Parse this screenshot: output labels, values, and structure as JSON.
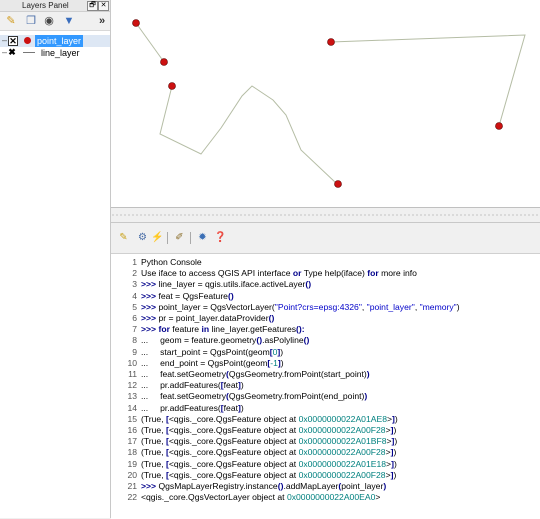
{
  "layers_panel": {
    "title": "Layers Panel",
    "float_button": "🗗",
    "close_button": "✕",
    "layers": [
      {
        "name": "point_layer",
        "visible": true,
        "selected": true
      },
      {
        "name": "line_layer",
        "visible": true,
        "selected": false
      }
    ]
  },
  "console": {
    "lines": [
      {
        "n": "1",
        "parts": [
          [
            "Python Console",
            ""
          ]
        ]
      },
      {
        "n": "2",
        "parts": [
          [
            "Use iface to access QGIS API interface ",
            ""
          ],
          [
            "or",
            "kw"
          ],
          [
            " Type help(iface) ",
            ""
          ],
          [
            "for",
            "kw"
          ],
          [
            " more info",
            ""
          ]
        ]
      },
      {
        "n": "3",
        "parts": [
          [
            ">>> ",
            "kw"
          ],
          [
            "line_layer = qgis.utils.iface.activeLayer",
            ""
          ],
          [
            "()",
            "kw"
          ]
        ]
      },
      {
        "n": "4",
        "parts": [
          [
            ">>> ",
            "kw"
          ],
          [
            "feat = QgsFeature",
            ""
          ],
          [
            "()",
            "kw"
          ]
        ]
      },
      {
        "n": "5",
        "parts": [
          [
            ">>> ",
            "kw"
          ],
          [
            "point_layer = QgsVectorLayer(",
            ""
          ],
          [
            "\"Point?crs=epsg:4326\"",
            "str"
          ],
          [
            ", ",
            ""
          ],
          [
            "\"point_layer\"",
            "str"
          ],
          [
            ", ",
            ""
          ],
          [
            "\"memory\"",
            "str"
          ],
          [
            ")",
            ""
          ]
        ]
      },
      {
        "n": "6",
        "parts": [
          [
            ">>> ",
            "kw"
          ],
          [
            "pr = point_layer.dataProvider",
            ""
          ],
          [
            "()",
            "kw"
          ]
        ]
      },
      {
        "n": "7",
        "parts": [
          [
            ">>> ",
            "kw"
          ],
          [
            "for",
            "kw"
          ],
          [
            " feature ",
            ""
          ],
          [
            "in",
            "kw"
          ],
          [
            " line_layer.getFeatures",
            ""
          ],
          [
            "():",
            "kw"
          ]
        ]
      },
      {
        "n": "8",
        "parts": [
          [
            "...     geom = feature.geometry",
            ""
          ],
          [
            "()",
            "kw"
          ],
          [
            ".asPolyline",
            ""
          ],
          [
            "()",
            "kw"
          ]
        ]
      },
      {
        "n": "9",
        "parts": [
          [
            "...     start_point = QgsPoint(geom",
            ""
          ],
          [
            "[",
            "kw"
          ],
          [
            "0",
            "num"
          ],
          [
            "]",
            "kw"
          ],
          [
            ")",
            ""
          ]
        ]
      },
      {
        "n": "10",
        "parts": [
          [
            "...     end_point = QgsPoint(geom",
            ""
          ],
          [
            "[",
            "kw"
          ],
          [
            "-1",
            "num"
          ],
          [
            "]",
            "kw"
          ],
          [
            ")",
            ""
          ]
        ]
      },
      {
        "n": "11",
        "parts": [
          [
            "...     feat.setGeometry",
            ""
          ],
          [
            "(",
            "kw"
          ],
          [
            "QgsGeometry.fromPoint(start_point)",
            ""
          ],
          [
            ")",
            "kw"
          ]
        ]
      },
      {
        "n": "12",
        "parts": [
          [
            "...     pr.addFeatures(",
            ""
          ],
          [
            "[",
            "kw"
          ],
          [
            "feat",
            ""
          ],
          [
            "]",
            "kw"
          ],
          [
            ")",
            ""
          ]
        ]
      },
      {
        "n": "13",
        "parts": [
          [
            "...     feat.setGeometry",
            ""
          ],
          [
            "(",
            "kw"
          ],
          [
            "QgsGeometry.fromPoint(end_point)",
            ""
          ],
          [
            ")",
            "kw"
          ]
        ]
      },
      {
        "n": "14",
        "parts": [
          [
            "...     pr.addFeatures(",
            ""
          ],
          [
            "[",
            "kw"
          ],
          [
            "feat",
            ""
          ],
          [
            "]",
            "kw"
          ],
          [
            ")",
            ""
          ]
        ]
      },
      {
        "n": "15",
        "parts": [
          [
            "(True, ",
            ""
          ],
          [
            "[",
            "kw"
          ],
          [
            "<qgis._core.QgsFeature object at ",
            ""
          ],
          [
            "0x0000000022A01AE8",
            "num"
          ],
          [
            ">",
            ""
          ],
          [
            "]",
            "kw"
          ],
          [
            ")",
            ""
          ]
        ]
      },
      {
        "n": "16",
        "parts": [
          [
            "(True, ",
            ""
          ],
          [
            "[",
            "kw"
          ],
          [
            "<qgis._core.QgsFeature object at ",
            ""
          ],
          [
            "0x0000000022A00F28",
            "num"
          ],
          [
            ">",
            ""
          ],
          [
            "]",
            "kw"
          ],
          [
            ")",
            ""
          ]
        ]
      },
      {
        "n": "17",
        "parts": [
          [
            "(True, ",
            ""
          ],
          [
            "[",
            "kw"
          ],
          [
            "<qgis._core.QgsFeature object at ",
            ""
          ],
          [
            "0x0000000022A01BF8",
            "num"
          ],
          [
            ">",
            ""
          ],
          [
            "]",
            "kw"
          ],
          [
            ")",
            ""
          ]
        ]
      },
      {
        "n": "18",
        "parts": [
          [
            "(True, ",
            ""
          ],
          [
            "[",
            "kw"
          ],
          [
            "<qgis._core.QgsFeature object at ",
            ""
          ],
          [
            "0x0000000022A00F28",
            "num"
          ],
          [
            ">",
            ""
          ],
          [
            "]",
            "kw"
          ],
          [
            ")",
            ""
          ]
        ]
      },
      {
        "n": "19",
        "parts": [
          [
            "(True, ",
            ""
          ],
          [
            "[",
            "kw"
          ],
          [
            "<qgis._core.QgsFeature object at ",
            ""
          ],
          [
            "0x0000000022A01E18",
            "num"
          ],
          [
            ">",
            ""
          ],
          [
            "]",
            "kw"
          ],
          [
            ")",
            ""
          ]
        ]
      },
      {
        "n": "20",
        "parts": [
          [
            "(True, ",
            ""
          ],
          [
            "[",
            "kw"
          ],
          [
            "<qgis._core.QgsFeature object at ",
            ""
          ],
          [
            "0x0000000022A00F28",
            "num"
          ],
          [
            ">",
            ""
          ],
          [
            "]",
            "kw"
          ],
          [
            ")",
            ""
          ]
        ]
      },
      {
        "n": "21",
        "parts": [
          [
            ">>> ",
            "kw"
          ],
          [
            "QgsMapLayerRegistry.instance",
            ""
          ],
          [
            "()",
            "kw"
          ],
          [
            ".addMapLayer",
            ""
          ],
          [
            "(",
            "kw"
          ],
          [
            "point_layer",
            ""
          ],
          [
            ")",
            "kw"
          ]
        ]
      },
      {
        "n": "22",
        "parts": [
          [
            "<qgis._core.QgsVectorLayer object at ",
            ""
          ],
          [
            "0x0000000022A00EA0",
            "num"
          ],
          [
            ">",
            ""
          ]
        ]
      }
    ]
  },
  "colors": {
    "point_fill": "#cc1111",
    "line_stroke": "#b5bda5",
    "keyword": "#00008b",
    "number": "#00807f"
  }
}
